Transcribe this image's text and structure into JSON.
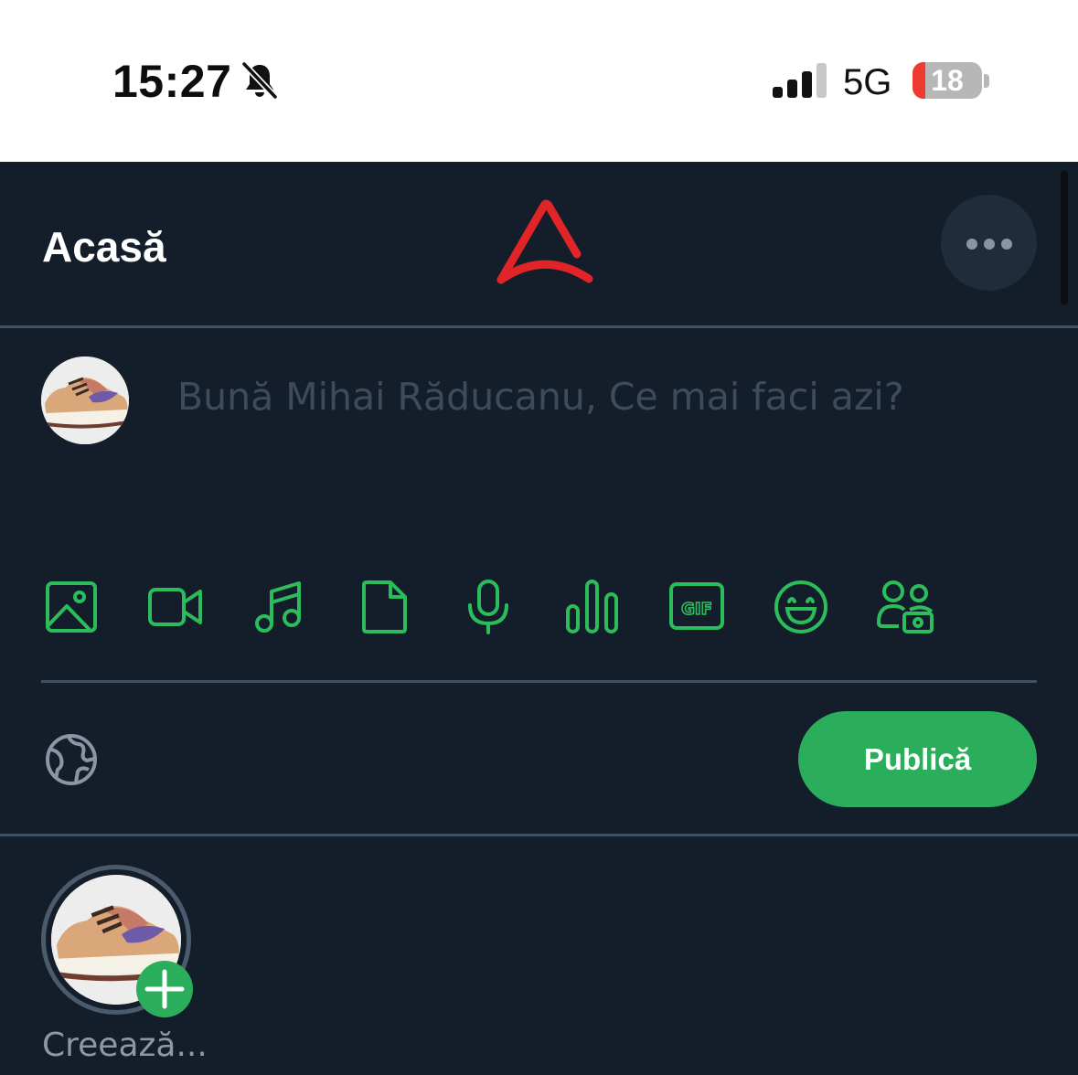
{
  "status_bar": {
    "time": "15:27",
    "network": "5G",
    "battery_level": "18",
    "battery_fraction": 0.18,
    "icons": [
      "bell-slash-icon",
      "cellular-signal-icon",
      "battery-icon"
    ]
  },
  "header": {
    "title": "Acasă",
    "logo": "brand-arc-logo-icon",
    "more_icon": "ellipsis-icon"
  },
  "composer": {
    "placeholder": "Bună Mihai Răducanu, Ce mai faci azi?",
    "avatar": "user-avatar-sneaker",
    "tools": [
      "image-icon",
      "video-camera-icon",
      "music-note-icon",
      "file-icon",
      "microphone-icon",
      "poll-bars-icon",
      "gif-icon",
      "emoji-icon",
      "paid-users-icon"
    ],
    "audience_icon": "globe-icon",
    "publish_label": "Publică"
  },
  "stories": {
    "create_label": "Creează...",
    "add_icon": "plus-icon"
  },
  "colors": {
    "background": "#141e2b",
    "accent_green": "#2bae5b",
    "logo_red": "#e02427",
    "divider": "#3f5264",
    "placeholder": "#3d4c5c"
  }
}
